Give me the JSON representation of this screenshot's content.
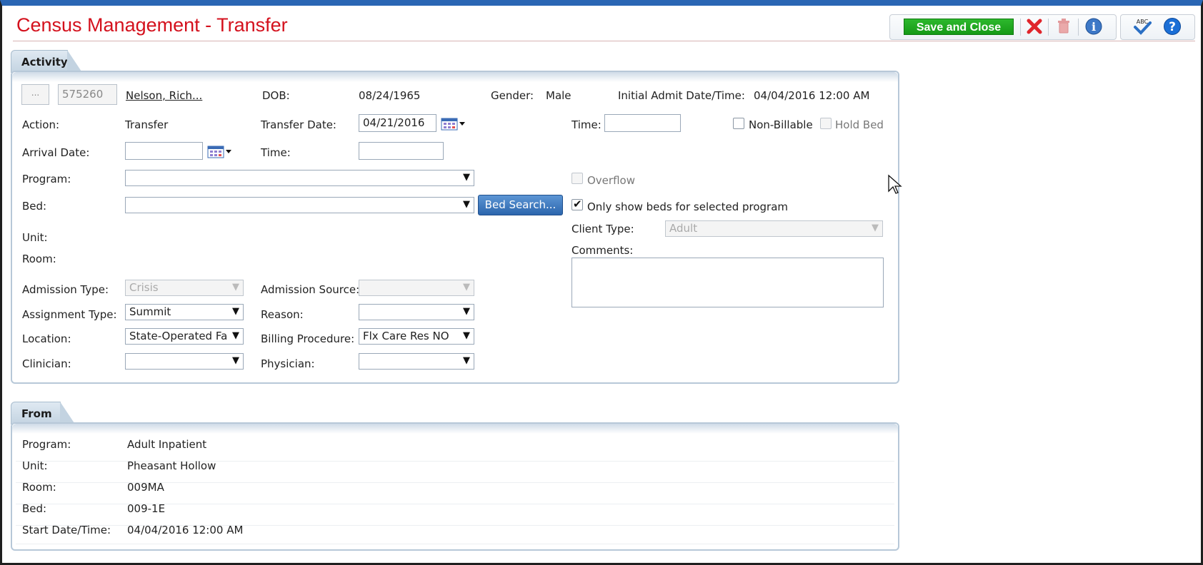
{
  "title": "Census Management - Transfer",
  "toolbar": {
    "save_label": "Save and Close",
    "icons": [
      "close-icon",
      "trash-icon",
      "info-icon",
      "spellcheck-icon",
      "help-icon"
    ],
    "spell_text": "ABC",
    "help_text": "?",
    "info_text": "i"
  },
  "activity": {
    "tab": "Activity",
    "ellipsis": "...",
    "client_id": "575260",
    "client_name": "Nelson, Rich...",
    "dob_label": "DOB:",
    "dob": "08/24/1965",
    "gender_label": "Gender:",
    "gender": "Male",
    "initial_admit_label": "Initial Admit Date/Time:",
    "initial_admit": "04/04/2016 12:00 AM",
    "action_label": "Action:",
    "action": "Transfer",
    "transfer_date_label": "Transfer Date:",
    "transfer_date": "04/21/2016",
    "time_label": "Time:",
    "time_value": "",
    "non_billable_label": "Non-Billable",
    "hold_bed_label": "Hold Bed",
    "arrival_date_label": "Arrival Date:",
    "arrival_date": "",
    "arrival_time_label": "Time:",
    "arrival_time": "",
    "program_label": "Program:",
    "program": "",
    "overflow_label": "Overflow",
    "bed_label": "Bed:",
    "bed": "",
    "bed_search_label": "Bed Search...",
    "only_show_label": "Only show beds for selected program",
    "only_show_checked": true,
    "client_type_label": "Client Type:",
    "client_type": "Adult",
    "unit_label": "Unit:",
    "room_label": "Room:",
    "comments_label": "Comments:",
    "admission_type_label": "Admission Type:",
    "admission_type": "Crisis",
    "admission_source_label": "Admission Source:",
    "admission_source": "",
    "assignment_type_label": "Assignment Type:",
    "assignment_type": "Summit",
    "reason_label": "Reason:",
    "reason": "",
    "location_label": "Location:",
    "location": "State-Operated Facility",
    "billing_label": "Billing Procedure:",
    "billing": "Flx Care Res NO",
    "clinician_label": "Clinician:",
    "clinician": "",
    "physician_label": "Physician:",
    "physician": ""
  },
  "from": {
    "tab": "From",
    "rows": [
      {
        "label": "Program:",
        "value": "Adult Inpatient"
      },
      {
        "label": "Unit:",
        "value": "Pheasant Hollow"
      },
      {
        "label": "Room:",
        "value": "009MA"
      },
      {
        "label": "Bed:",
        "value": "009-1E"
      },
      {
        "label": "Start Date/Time:",
        "value": "04/04/2016 12:00 AM"
      }
    ]
  },
  "colors": {
    "title_red": "#d4111d",
    "save_green": "#1aa51a",
    "frame_blue": "#2a66b4",
    "bed_search_blue": "#2c66ad"
  }
}
